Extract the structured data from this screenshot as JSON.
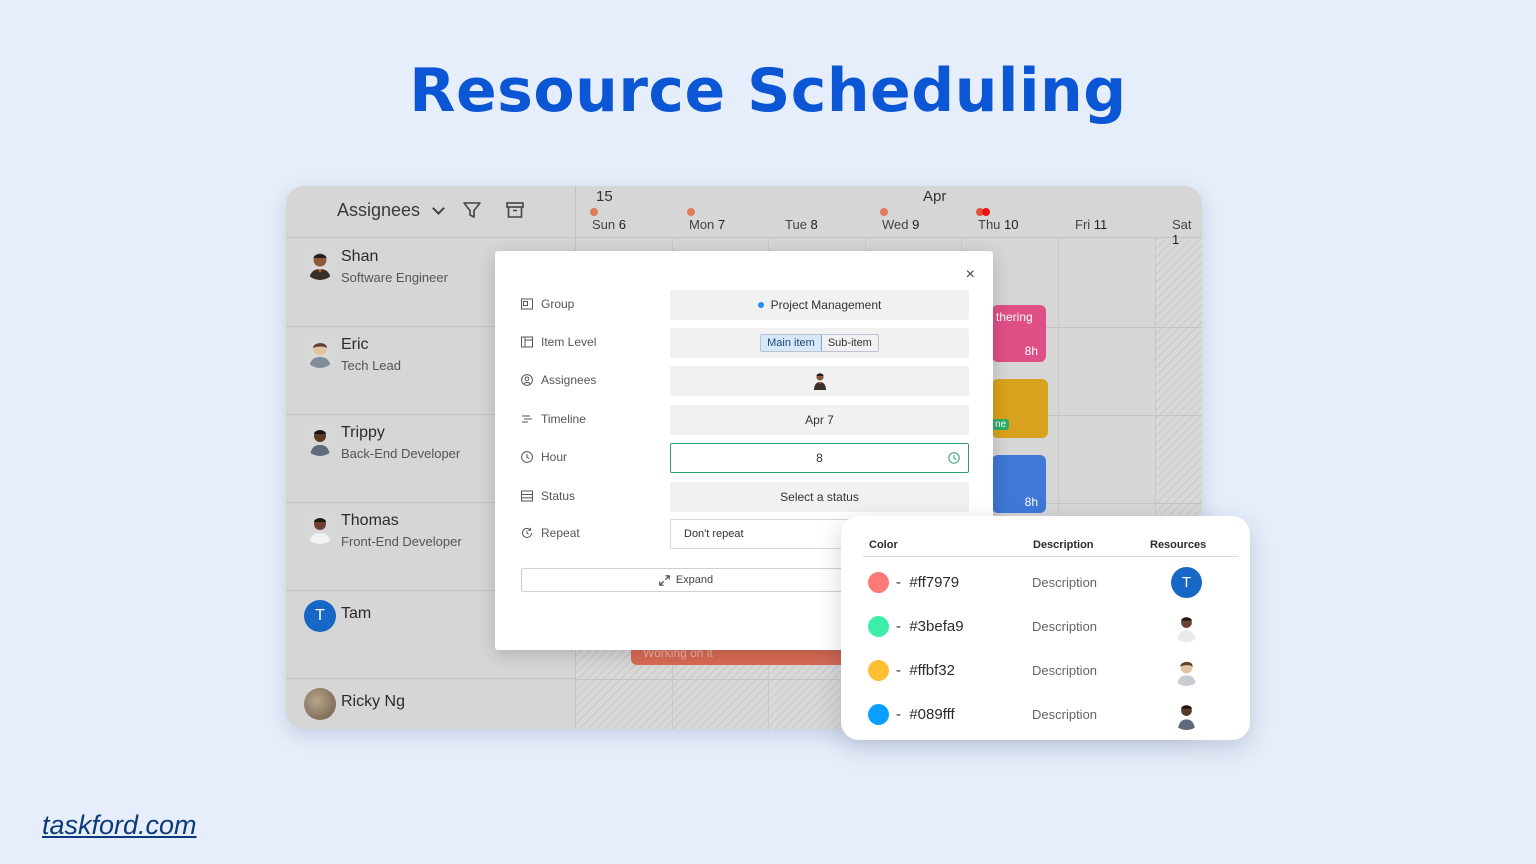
{
  "headline": "Resource Scheduling",
  "site": "taskford.com",
  "colors": {
    "brand": "#0a56d4",
    "link": "#0d3a7a"
  },
  "scheduler": {
    "assignees_label": "Assignees",
    "people": [
      {
        "name": "Shan",
        "role": "Software Engineer"
      },
      {
        "name": "Eric",
        "role": "Tech Lead"
      },
      {
        "name": "Trippy",
        "role": "Back-End Developer"
      },
      {
        "name": "Thomas",
        "role": "Front-End Developer"
      },
      {
        "name": "Tam",
        "role": "",
        "initial": "T"
      },
      {
        "name": "Ricky Ng",
        "role": ""
      }
    ],
    "week_number": "15",
    "month": "Apr",
    "days": [
      {
        "dow": "Sun",
        "date": "6"
      },
      {
        "dow": "Mon",
        "date": "7"
      },
      {
        "dow": "Tue",
        "date": "8"
      },
      {
        "dow": "Wed",
        "date": "9"
      },
      {
        "dow": "Thu",
        "date": "10"
      },
      {
        "dow": "Fri",
        "date": "11"
      },
      {
        "dow": "Sat",
        "date": "1"
      }
    ],
    "events": [
      {
        "label": "thering",
        "hours": "8h",
        "color": "#de4f86"
      },
      {
        "label": "ne",
        "hours": "",
        "color": "#d9a21e"
      },
      {
        "label": "",
        "hours": "8h",
        "color": "#3f78d8"
      },
      {
        "label": "Working on it",
        "hours": "",
        "color": "#d96b55"
      }
    ]
  },
  "modal": {
    "close": "×",
    "fields": {
      "group": {
        "label": "Group",
        "value": "Project Management"
      },
      "item_level": {
        "label": "Item Level",
        "options": [
          "Main item",
          "Sub-item"
        ],
        "selected": "Main item"
      },
      "assignees": {
        "label": "Assignees"
      },
      "timeline": {
        "label": "Timeline",
        "value": "Apr 7"
      },
      "hour": {
        "label": "Hour",
        "value": "8"
      },
      "status": {
        "label": "Status",
        "value": "Select a status"
      },
      "repeat": {
        "label": "Repeat",
        "value": "Don't repeat"
      }
    },
    "expand_label": "Expand"
  },
  "color_card": {
    "headers": {
      "color": "Color",
      "description": "Description",
      "resources": "Resources"
    },
    "rows": [
      {
        "hex": "#ff7979",
        "dash": "-",
        "description": "Description",
        "resource": "T"
      },
      {
        "hex": "#3befa9",
        "dash": "-",
        "description": "Description"
      },
      {
        "hex": "#ffbf32",
        "dash": "-",
        "description": "Description"
      },
      {
        "hex": "#089fff",
        "dash": "-",
        "description": "Description"
      }
    ]
  }
}
